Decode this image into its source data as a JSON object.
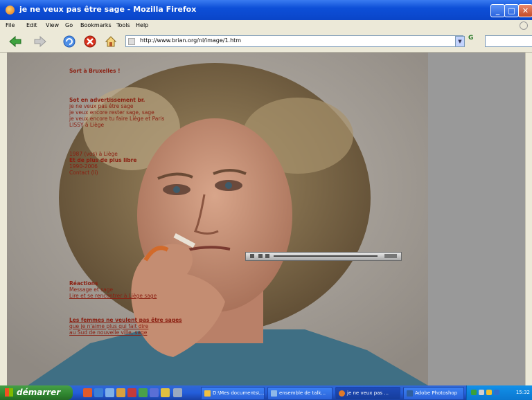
{
  "window": {
    "title": "je ne veux pas être sage - Mozilla Firefox"
  },
  "menu": [
    "File",
    "Edit",
    "View",
    "Go",
    "Bookmarks",
    "Tools",
    "Help"
  ],
  "address": {
    "url": "http://www.brian.org/nl/image/1.htm"
  },
  "page": {
    "block1": [
      {
        "text": "Sort à Bruxelles !",
        "style": "bold"
      }
    ],
    "block2": [
      {
        "text": "Sot en advertissement br.",
        "style": "bold"
      },
      {
        "text": "je ne veux pas être sage"
      },
      {
        "text": "je veux encore rester sage, sage"
      },
      {
        "text": "je veux encore tu faire Liège et Paris"
      },
      {
        "text": "LISSY à Liège"
      }
    ],
    "block3": [
      {
        "text": "1987 (vos) à Liège"
      },
      {
        "text": "Et de plus de plus libre",
        "style": "bold"
      },
      {
        "text": "1990-2006"
      },
      {
        "text": "Contact (li)"
      }
    ],
    "block4": [
      {
        "text": "Réactions",
        "style": "bold"
      },
      {
        "text": "Message et sage"
      },
      {
        "text": "Lire et se rencontrer à Liège sage",
        "style": "underline"
      }
    ],
    "block5": [
      {
        "text": "Les femmes ne veulent pas être sages",
        "style": "bold underline"
      },
      {
        "text": "que je n'aime plus qui fait dire",
        "style": "underline"
      },
      {
        "text": "au Sud de nouvelle ville, sage",
        "style": "underline"
      }
    ]
  },
  "taskbar": {
    "start_label": "démarrer",
    "tasks": [
      {
        "label": "D:\\Mes documents\\..."
      },
      {
        "label": "ensemble de talk..."
      },
      {
        "label": "je ne veux pas ..."
      },
      {
        "label": "Adobe Photoshop"
      }
    ],
    "clock": "15:32"
  }
}
